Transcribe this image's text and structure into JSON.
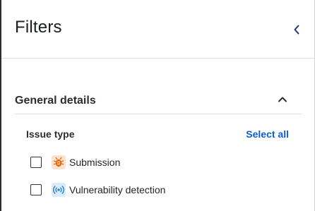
{
  "header": {
    "title": "Filters"
  },
  "section": {
    "title": "General details",
    "expanded": true
  },
  "issue_type": {
    "label": "Issue type",
    "select_all_label": "Select all",
    "options": [
      {
        "label": "Submission",
        "checked": false,
        "icon": "bug-icon",
        "icon_color": "#e8650d"
      },
      {
        "label": "Vulnerability detection",
        "checked": false,
        "icon": "radar-icon",
        "icon_color": "#1f78c8"
      }
    ]
  },
  "colors": {
    "link": "#0b5cd5",
    "divider": "#d9dce1",
    "text": "#1f2328"
  }
}
